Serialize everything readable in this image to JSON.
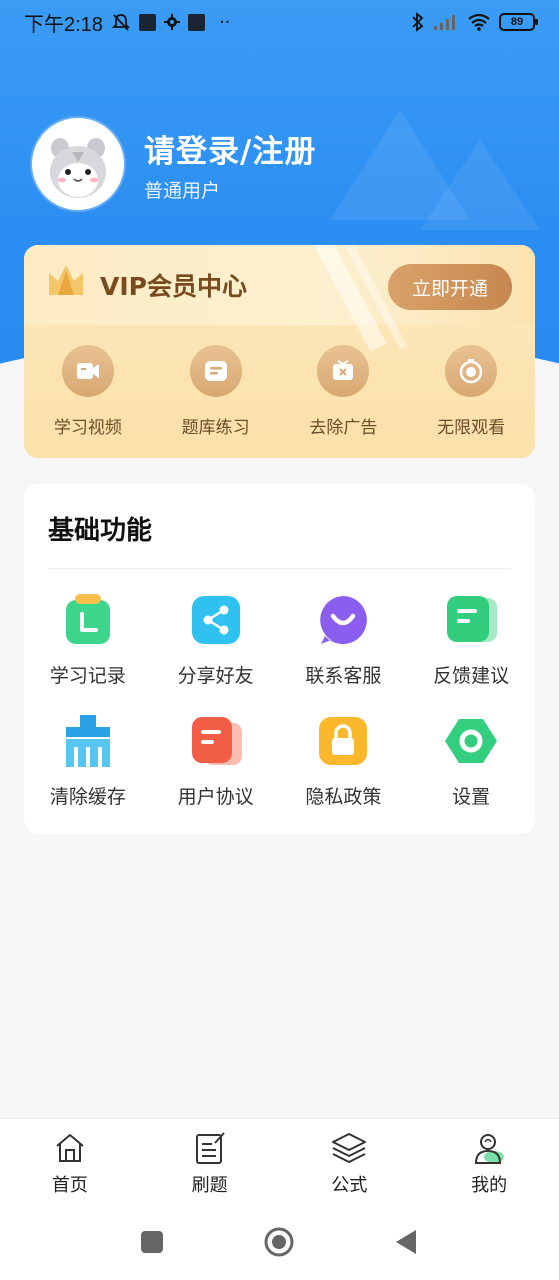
{
  "status_bar": {
    "time": "下午2:18",
    "battery": "89"
  },
  "profile": {
    "login_prompt": "请登录/注册",
    "user_level": "普通用户"
  },
  "vip": {
    "title": "VIP会员中心",
    "cta": "立即开通",
    "items": [
      {
        "label": "学习视频",
        "icon": "video-icon"
      },
      {
        "label": "题库练习",
        "icon": "message-icon"
      },
      {
        "label": "去除广告",
        "icon": "remove-ad-icon"
      },
      {
        "label": "无限观看",
        "icon": "timer-icon"
      }
    ]
  },
  "basic": {
    "title": "基础功能",
    "items": [
      {
        "label": "学习记录",
        "icon": "clock-record-icon"
      },
      {
        "label": "分享好友",
        "icon": "share-icon"
      },
      {
        "label": "联系客服",
        "icon": "customer-service-icon"
      },
      {
        "label": "反馈建议",
        "icon": "feedback-icon"
      },
      {
        "label": "清除缓存",
        "icon": "broom-icon"
      },
      {
        "label": "用户协议",
        "icon": "document-icon"
      },
      {
        "label": "隐私政策",
        "icon": "lock-icon"
      },
      {
        "label": "设置",
        "icon": "gear-icon"
      }
    ]
  },
  "tabs": [
    {
      "label": "首页",
      "icon": "home-icon"
    },
    {
      "label": "刷题",
      "icon": "exercise-icon"
    },
    {
      "label": "公式",
      "icon": "layers-icon"
    },
    {
      "label": "我的",
      "icon": "profile-icon",
      "active": true
    }
  ],
  "colors": {
    "header_blue": "#2c8ef2",
    "vip_gold": "#c7884f",
    "background": "#f6f6f7"
  }
}
